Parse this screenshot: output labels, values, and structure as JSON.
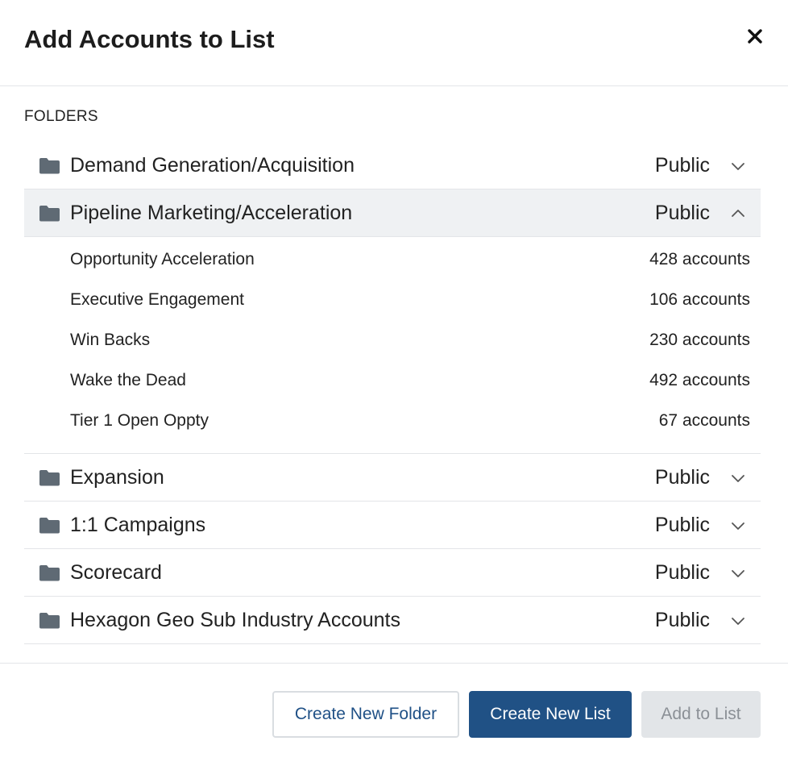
{
  "modal": {
    "title": "Add Accounts to List"
  },
  "section_label": "FOLDERS",
  "folders": [
    {
      "name": "Demand Generation/Acquisition",
      "visibility": "Public",
      "expanded": false
    },
    {
      "name": "Pipeline Marketing/Acceleration",
      "visibility": "Public",
      "expanded": true,
      "lists": [
        {
          "name": "Opportunity Acceleration",
          "count": "428 accounts"
        },
        {
          "name": "Executive Engagement",
          "count": "106 accounts"
        },
        {
          "name": "Win Backs",
          "count": "230 accounts"
        },
        {
          "name": "Wake the Dead",
          "count": "492 accounts"
        },
        {
          "name": "Tier 1 Open Oppty",
          "count": "67 accounts"
        }
      ]
    },
    {
      "name": "Expansion",
      "visibility": "Public",
      "expanded": false
    },
    {
      "name": "1:1 Campaigns",
      "visibility": "Public",
      "expanded": false
    },
    {
      "name": "Scorecard",
      "visibility": "Public",
      "expanded": false
    },
    {
      "name": "Hexagon Geo Sub Industry Accounts",
      "visibility": "Public",
      "expanded": false
    }
  ],
  "footer": {
    "create_folder_label": "Create New Folder",
    "create_list_label": "Create New List",
    "add_to_list_label": "Add to List"
  },
  "icons": {
    "close": "close-icon",
    "folder": "folder-icon",
    "expand": "chevron-down-icon",
    "collapse": "chevron-up-icon"
  },
  "colors": {
    "primary": "#205185",
    "primary_text": "#1f5086",
    "folder_icon": "#5f6a74",
    "expanded_row_bg": "#eff1f3",
    "divider": "#e3e5e8",
    "disabled_bg": "#e2e5e8",
    "disabled_text": "#8b9096"
  }
}
